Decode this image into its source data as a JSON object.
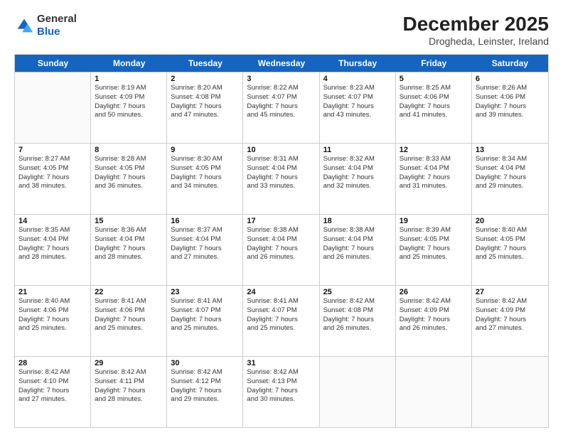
{
  "logo": {
    "general": "General",
    "blue": "Blue"
  },
  "header": {
    "month_year": "December 2025",
    "location": "Drogheda, Leinster, Ireland"
  },
  "days_of_week": [
    "Sunday",
    "Monday",
    "Tuesday",
    "Wednesday",
    "Thursday",
    "Friday",
    "Saturday"
  ],
  "weeks": [
    [
      {
        "day": "",
        "empty": true
      },
      {
        "day": "1",
        "sunrise": "Sunrise: 8:19 AM",
        "sunset": "Sunset: 4:09 PM",
        "daylight": "Daylight: 7 hours and 50 minutes."
      },
      {
        "day": "2",
        "sunrise": "Sunrise: 8:20 AM",
        "sunset": "Sunset: 4:08 PM",
        "daylight": "Daylight: 7 hours and 47 minutes."
      },
      {
        "day": "3",
        "sunrise": "Sunrise: 8:22 AM",
        "sunset": "Sunset: 4:07 PM",
        "daylight": "Daylight: 7 hours and 45 minutes."
      },
      {
        "day": "4",
        "sunrise": "Sunrise: 8:23 AM",
        "sunset": "Sunset: 4:07 PM",
        "daylight": "Daylight: 7 hours and 43 minutes."
      },
      {
        "day": "5",
        "sunrise": "Sunrise: 8:25 AM",
        "sunset": "Sunset: 4:06 PM",
        "daylight": "Daylight: 7 hours and 41 minutes."
      },
      {
        "day": "6",
        "sunrise": "Sunrise: 8:26 AM",
        "sunset": "Sunset: 4:06 PM",
        "daylight": "Daylight: 7 hours and 39 minutes."
      }
    ],
    [
      {
        "day": "7",
        "sunrise": "Sunrise: 8:27 AM",
        "sunset": "Sunset: 4:05 PM",
        "daylight": "Daylight: 7 hours and 38 minutes."
      },
      {
        "day": "8",
        "sunrise": "Sunrise: 8:28 AM",
        "sunset": "Sunset: 4:05 PM",
        "daylight": "Daylight: 7 hours and 36 minutes."
      },
      {
        "day": "9",
        "sunrise": "Sunrise: 8:30 AM",
        "sunset": "Sunset: 4:05 PM",
        "daylight": "Daylight: 7 hours and 34 minutes."
      },
      {
        "day": "10",
        "sunrise": "Sunrise: 8:31 AM",
        "sunset": "Sunset: 4:04 PM",
        "daylight": "Daylight: 7 hours and 33 minutes."
      },
      {
        "day": "11",
        "sunrise": "Sunrise: 8:32 AM",
        "sunset": "Sunset: 4:04 PM",
        "daylight": "Daylight: 7 hours and 32 minutes."
      },
      {
        "day": "12",
        "sunrise": "Sunrise: 8:33 AM",
        "sunset": "Sunset: 4:04 PM",
        "daylight": "Daylight: 7 hours and 31 minutes."
      },
      {
        "day": "13",
        "sunrise": "Sunrise: 8:34 AM",
        "sunset": "Sunset: 4:04 PM",
        "daylight": "Daylight: 7 hours and 29 minutes."
      }
    ],
    [
      {
        "day": "14",
        "sunrise": "Sunrise: 8:35 AM",
        "sunset": "Sunset: 4:04 PM",
        "daylight": "Daylight: 7 hours and 28 minutes."
      },
      {
        "day": "15",
        "sunrise": "Sunrise: 8:36 AM",
        "sunset": "Sunset: 4:04 PM",
        "daylight": "Daylight: 7 hours and 28 minutes."
      },
      {
        "day": "16",
        "sunrise": "Sunrise: 8:37 AM",
        "sunset": "Sunset: 4:04 PM",
        "daylight": "Daylight: 7 hours and 27 minutes."
      },
      {
        "day": "17",
        "sunrise": "Sunrise: 8:38 AM",
        "sunset": "Sunset: 4:04 PM",
        "daylight": "Daylight: 7 hours and 26 minutes."
      },
      {
        "day": "18",
        "sunrise": "Sunrise: 8:38 AM",
        "sunset": "Sunset: 4:04 PM",
        "daylight": "Daylight: 7 hours and 26 minutes."
      },
      {
        "day": "19",
        "sunrise": "Sunrise: 8:39 AM",
        "sunset": "Sunset: 4:05 PM",
        "daylight": "Daylight: 7 hours and 25 minutes."
      },
      {
        "day": "20",
        "sunrise": "Sunrise: 8:40 AM",
        "sunset": "Sunset: 4:05 PM",
        "daylight": "Daylight: 7 hours and 25 minutes."
      }
    ],
    [
      {
        "day": "21",
        "sunrise": "Sunrise: 8:40 AM",
        "sunset": "Sunset: 4:06 PM",
        "daylight": "Daylight: 7 hours and 25 minutes."
      },
      {
        "day": "22",
        "sunrise": "Sunrise: 8:41 AM",
        "sunset": "Sunset: 4:06 PM",
        "daylight": "Daylight: 7 hours and 25 minutes."
      },
      {
        "day": "23",
        "sunrise": "Sunrise: 8:41 AM",
        "sunset": "Sunset: 4:07 PM",
        "daylight": "Daylight: 7 hours and 25 minutes."
      },
      {
        "day": "24",
        "sunrise": "Sunrise: 8:41 AM",
        "sunset": "Sunset: 4:07 PM",
        "daylight": "Daylight: 7 hours and 25 minutes."
      },
      {
        "day": "25",
        "sunrise": "Sunrise: 8:42 AM",
        "sunset": "Sunset: 4:08 PM",
        "daylight": "Daylight: 7 hours and 26 minutes."
      },
      {
        "day": "26",
        "sunrise": "Sunrise: 8:42 AM",
        "sunset": "Sunset: 4:09 PM",
        "daylight": "Daylight: 7 hours and 26 minutes."
      },
      {
        "day": "27",
        "sunrise": "Sunrise: 8:42 AM",
        "sunset": "Sunset: 4:09 PM",
        "daylight": "Daylight: 7 hours and 27 minutes."
      }
    ],
    [
      {
        "day": "28",
        "sunrise": "Sunrise: 8:42 AM",
        "sunset": "Sunset: 4:10 PM",
        "daylight": "Daylight: 7 hours and 27 minutes."
      },
      {
        "day": "29",
        "sunrise": "Sunrise: 8:42 AM",
        "sunset": "Sunset: 4:11 PM",
        "daylight": "Daylight: 7 hours and 28 minutes."
      },
      {
        "day": "30",
        "sunrise": "Sunrise: 8:42 AM",
        "sunset": "Sunset: 4:12 PM",
        "daylight": "Daylight: 7 hours and 29 minutes."
      },
      {
        "day": "31",
        "sunrise": "Sunrise: 8:42 AM",
        "sunset": "Sunset: 4:13 PM",
        "daylight": "Daylight: 7 hours and 30 minutes."
      },
      {
        "day": "",
        "empty": true
      },
      {
        "day": "",
        "empty": true
      },
      {
        "day": "",
        "empty": true
      }
    ]
  ]
}
